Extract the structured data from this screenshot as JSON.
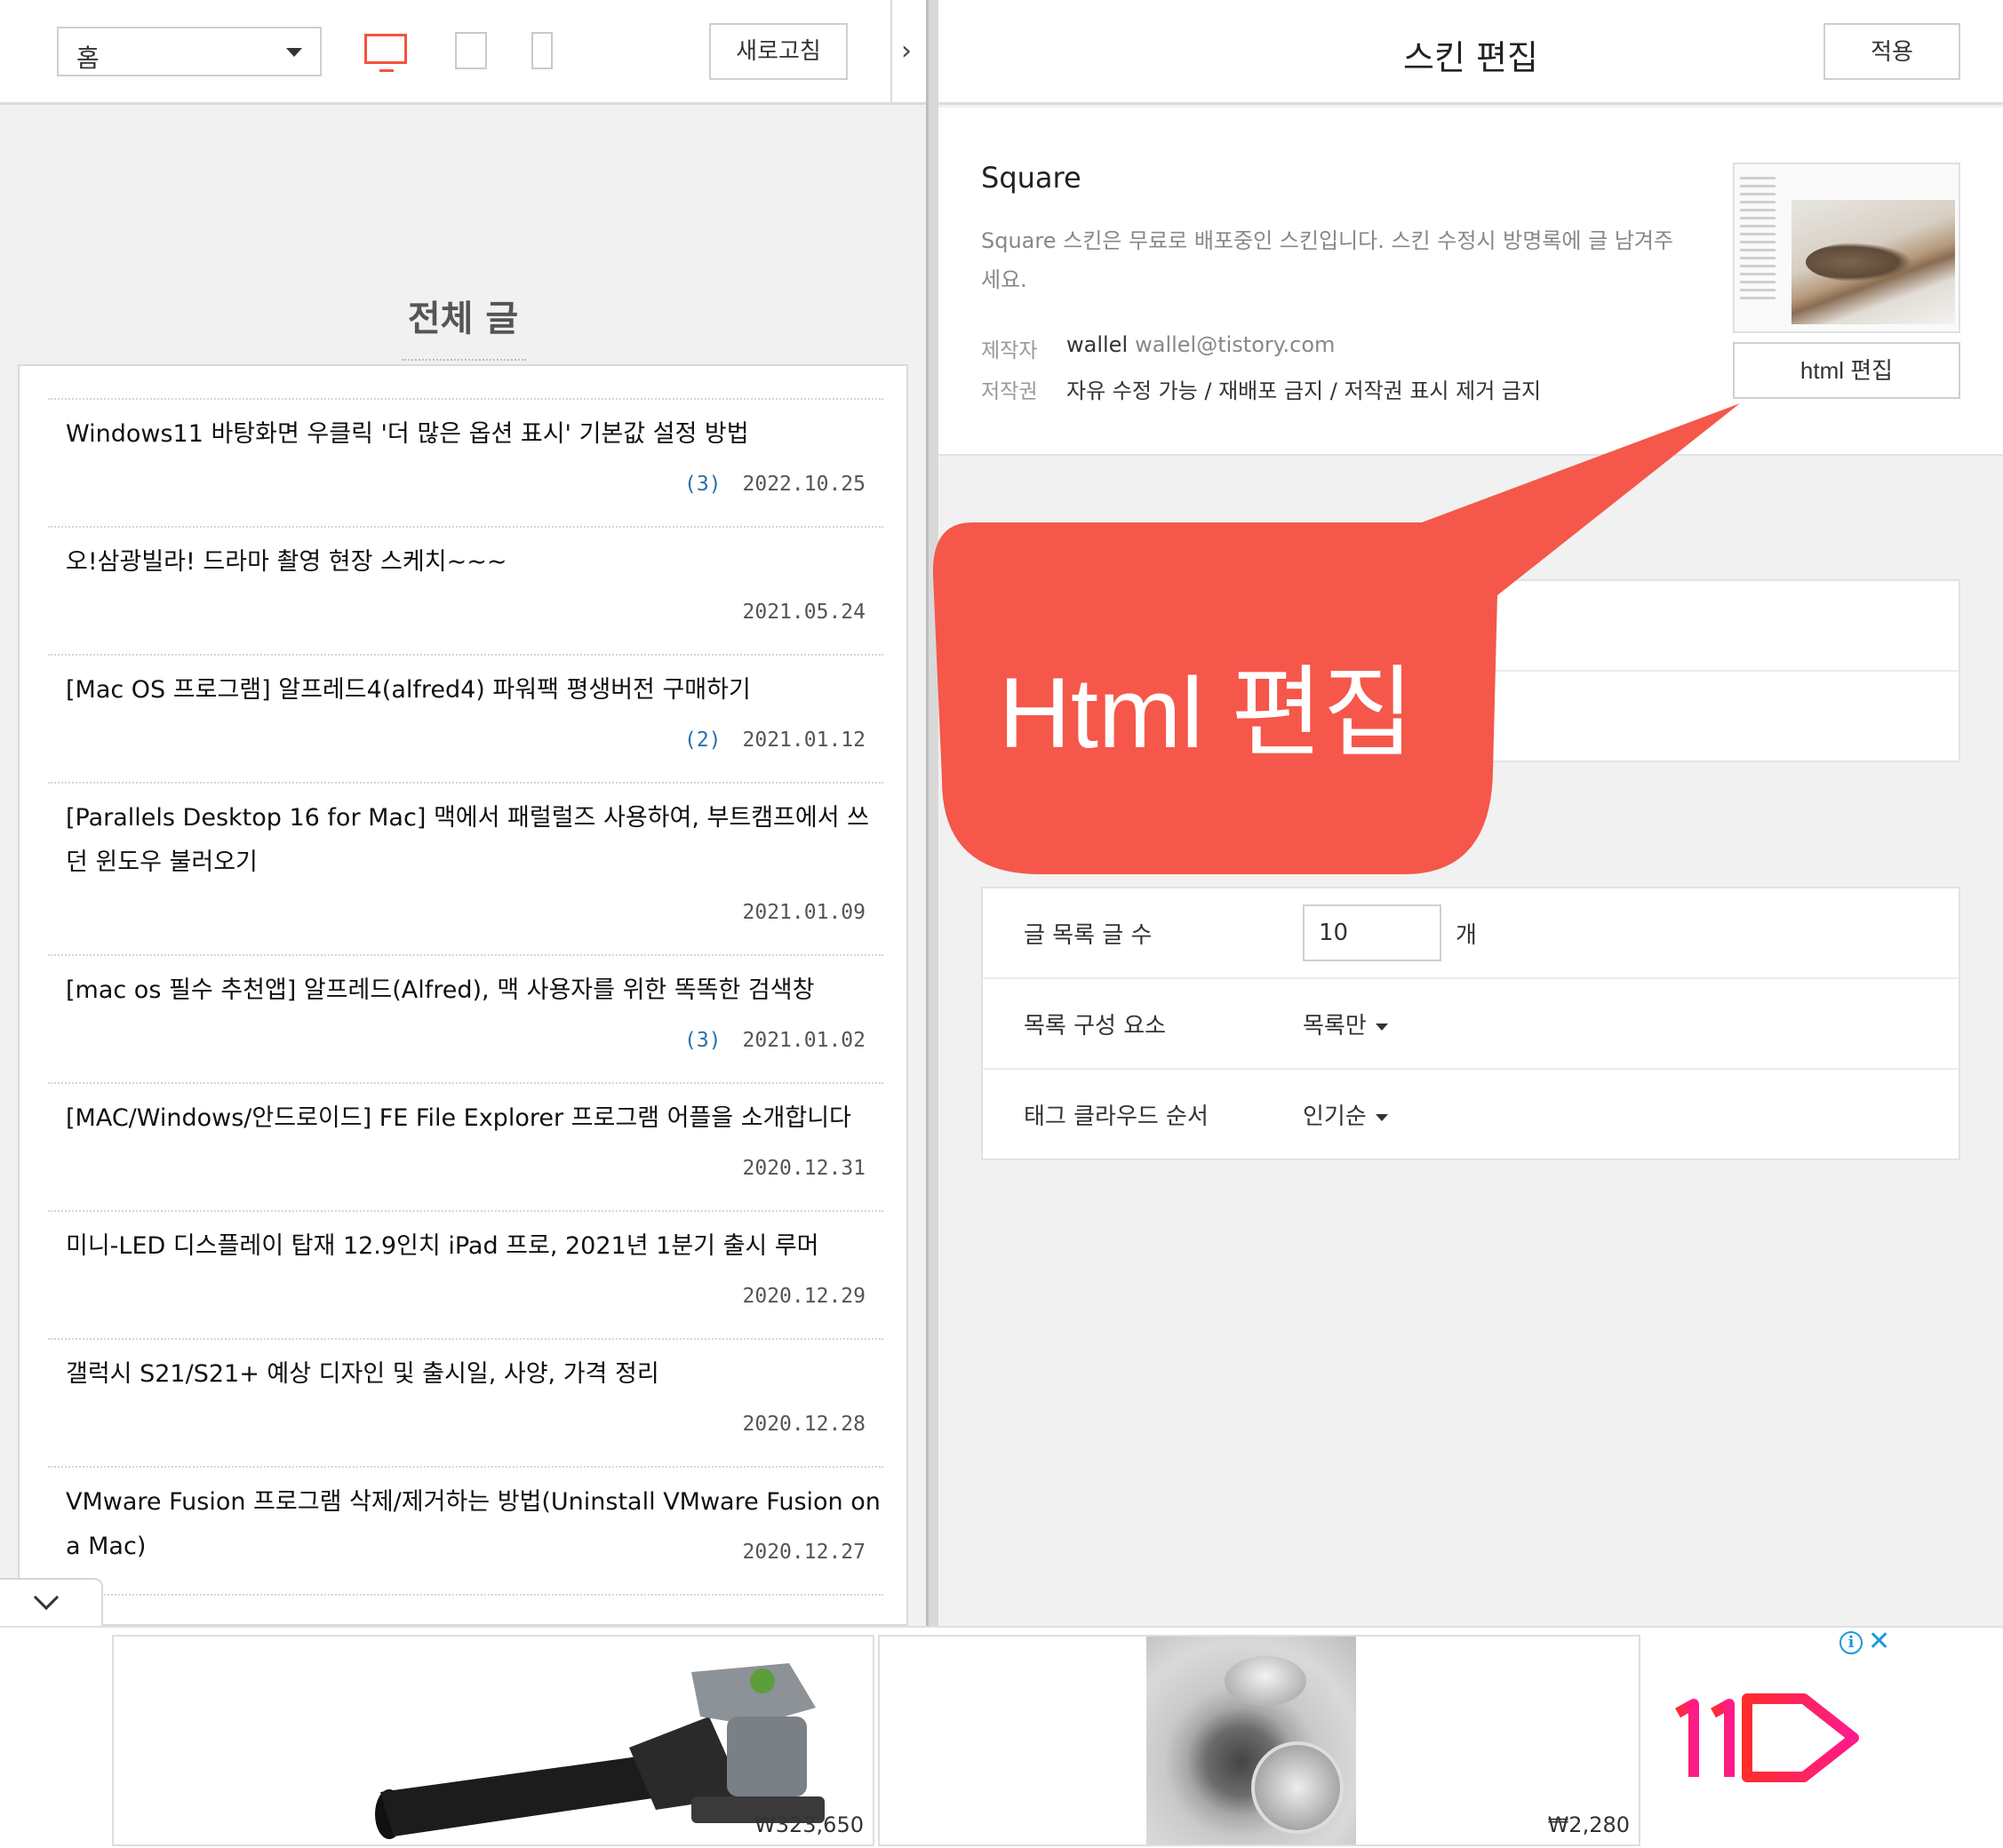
{
  "left_toolbar": {
    "page_select_value": "홈",
    "refresh_label": "새로고침"
  },
  "board": {
    "title": "전체 글",
    "posts": [
      {
        "title": "Windows11 바탕화면 우클릭 '더 많은 옵션 표시' 기본값 설정 방법",
        "comments": "(3)",
        "date": "2022.10.25"
      },
      {
        "title": "오!삼광빌라! 드라마 촬영 현장 스케치~~~",
        "comments": "",
        "date": "2021.05.24"
      },
      {
        "title": "[Mac OS 프로그램] 알프레드4(alfred4) 파워팩 평생버전 구매하기",
        "comments": "(2)",
        "date": "2021.01.12"
      },
      {
        "title": "[Parallels Desktop 16 for Mac] 맥에서 패럴럴즈 사용하여, 부트캠프에서 쓰던 윈도우 불러오기",
        "comments": "",
        "date": "2021.01.09"
      },
      {
        "title": "[mac os 필수 추천앱] 알프레드(Alfred), 맥 사용자를 위한 똑똑한 검색창",
        "comments": "(3)",
        "date": "2021.01.02"
      },
      {
        "title": "[MAC/Windows/안드로이드] FE File Explorer 프로그램 어플을 소개합니다",
        "comments": "",
        "date": "2020.12.31"
      },
      {
        "title": "미니-LED 디스플레이 탑재 12.9인치 iPad 프로, 2021년 1분기 출시 루머",
        "comments": "",
        "date": "2020.12.29"
      },
      {
        "title": "갤럭시 S21/S21+ 예상 디자인 및 출시일, 사양, 가격 정리",
        "comments": "",
        "date": "2020.12.28"
      },
      {
        "title": "VMware Fusion 프로그램 삭제/제거하는 방법(Uninstall VMware Fusion on a Mac)",
        "comments": "",
        "date": "2020.12.27"
      }
    ]
  },
  "right_panel": {
    "title": "스킨 편집",
    "apply_label": "적용",
    "skin": {
      "name": "Square",
      "description": "Square 스킨은 무료로 배포중인 스킨입니다. 스킨 수정시 방명록에 글 남겨주세요.",
      "author_label": "제작자",
      "author_name": "wallel",
      "author_email": "wallel@tistory.com",
      "license_label": "저작권",
      "license_value": "자유 수정 가능 / 재배포 금지 / 저작권 표시 제거 금지",
      "html_edit_label": "html 편집"
    },
    "settings": {
      "post_count_label": "글 목록 글 수",
      "post_count_value": "10",
      "post_count_unit": "개",
      "list_components_label": "목록 구성 요소",
      "list_components_value": "목록만",
      "tag_cloud_label": "태그 클라우드 순서",
      "tag_cloud_value": "인기순"
    }
  },
  "callout": {
    "text": "Html 편집",
    "color": "#f5574a"
  },
  "ads": {
    "items": [
      {
        "price": "₩323,650"
      },
      {
        "price": "₩2,280"
      }
    ]
  },
  "colors": {
    "accent_red": "#f5533d",
    "comment_blue": "#2b70a8"
  }
}
